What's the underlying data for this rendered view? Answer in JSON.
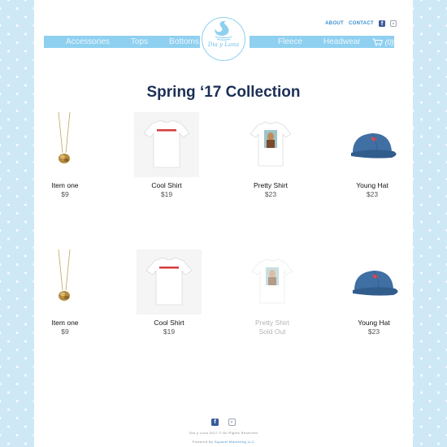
{
  "header": {
    "links": {
      "about": "ABOUT",
      "contact": "CONTACT"
    },
    "logo_text": "Dia y Luna",
    "nav_left": [
      "Accessories",
      "Tops",
      "Bottoms"
    ],
    "nav_right": [
      "Fleece",
      "Headwear"
    ],
    "cart_count": "(0)"
  },
  "collection_title": "Spring ‘17 Collection",
  "rows": [
    [
      {
        "name": "Item one",
        "price": "$9",
        "image": "necklace"
      },
      {
        "name": "Cool Shirt",
        "price": "$19",
        "image": "white-tshirt"
      },
      {
        "name": "Pretty Shirt",
        "price": "$23",
        "image": "photo-tshirt"
      },
      {
        "name": "Young Hat",
        "price": "$23",
        "image": "denim-cap"
      }
    ],
    [
      {
        "name": "Item one",
        "price": "$9",
        "image": "necklace"
      },
      {
        "name": "Cool Shirt",
        "price": "$19",
        "image": "white-tshirt"
      },
      {
        "name": "Pretty Shirt",
        "price": "Sold Out",
        "image": "photo-tshirt",
        "sold_out": true
      },
      {
        "name": "Young Hat",
        "price": "$23",
        "image": "denim-cap"
      }
    ]
  ],
  "footer": {
    "copyright": "Dia y Luna 2017 © All Rights Reserved",
    "powered_prefix": "Powered By",
    "powered_by": "Squarel Marketing LLC"
  },
  "colors": {
    "accent": "#8fd0f0",
    "title": "#1c2f55",
    "link": "#3a8fd0",
    "facebook": "#3b5d9c"
  },
  "icons": [
    "facebook-icon",
    "instagram-icon",
    "cart-icon",
    "swan-logo-icon"
  ]
}
